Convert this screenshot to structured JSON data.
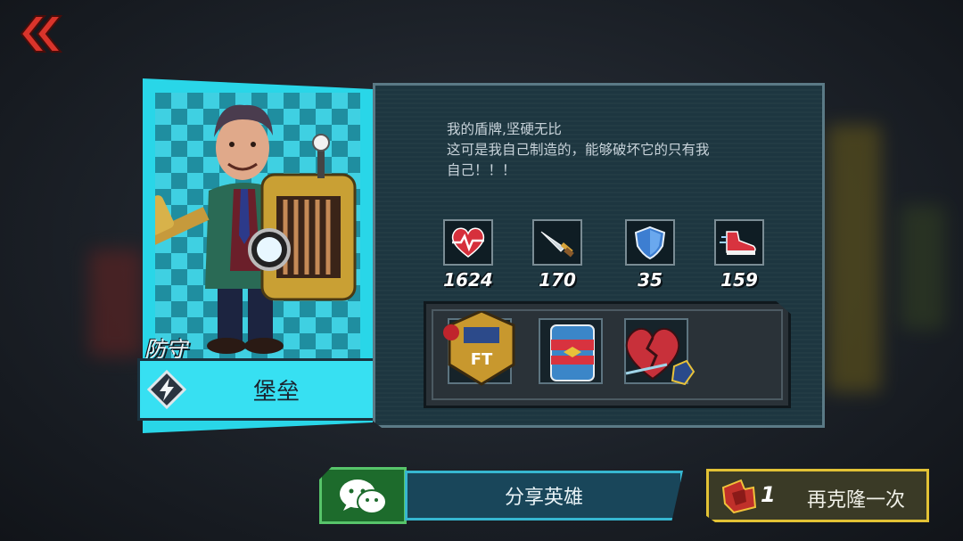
{
  "hero": {
    "role": "防守",
    "class_name": "堡垒",
    "class_icon": "lightning-bolt-icon",
    "description": [
      "我的盾牌,坚硬无比",
      "这可是我自己制造的，能够破坏它的只有我",
      "自己！！！"
    ]
  },
  "stats": [
    {
      "name": "health",
      "icon": "heart-icon",
      "value": "1624"
    },
    {
      "name": "attack",
      "icon": "sword-icon",
      "value": "170"
    },
    {
      "name": "defense",
      "icon": "shield-icon",
      "value": "35"
    },
    {
      "name": "speed",
      "icon": "sneaker-icon",
      "value": "159"
    }
  ],
  "equipment": [
    {
      "icon": "ft-badge-icon"
    },
    {
      "icon": "soda-can-icon"
    },
    {
      "icon": "broken-heart-icon"
    }
  ],
  "actions": {
    "share_label": "分享英雄",
    "share_icon": "wechat-icon",
    "clone_count": "1",
    "clone_label": "再克隆一次",
    "clone_icon": "clone-token-icon"
  },
  "colors": {
    "accent_cyan": "#29d6e8",
    "share_green": "#57c46a",
    "clone_gold": "#e2c235",
    "back_red": "#c0392b"
  }
}
